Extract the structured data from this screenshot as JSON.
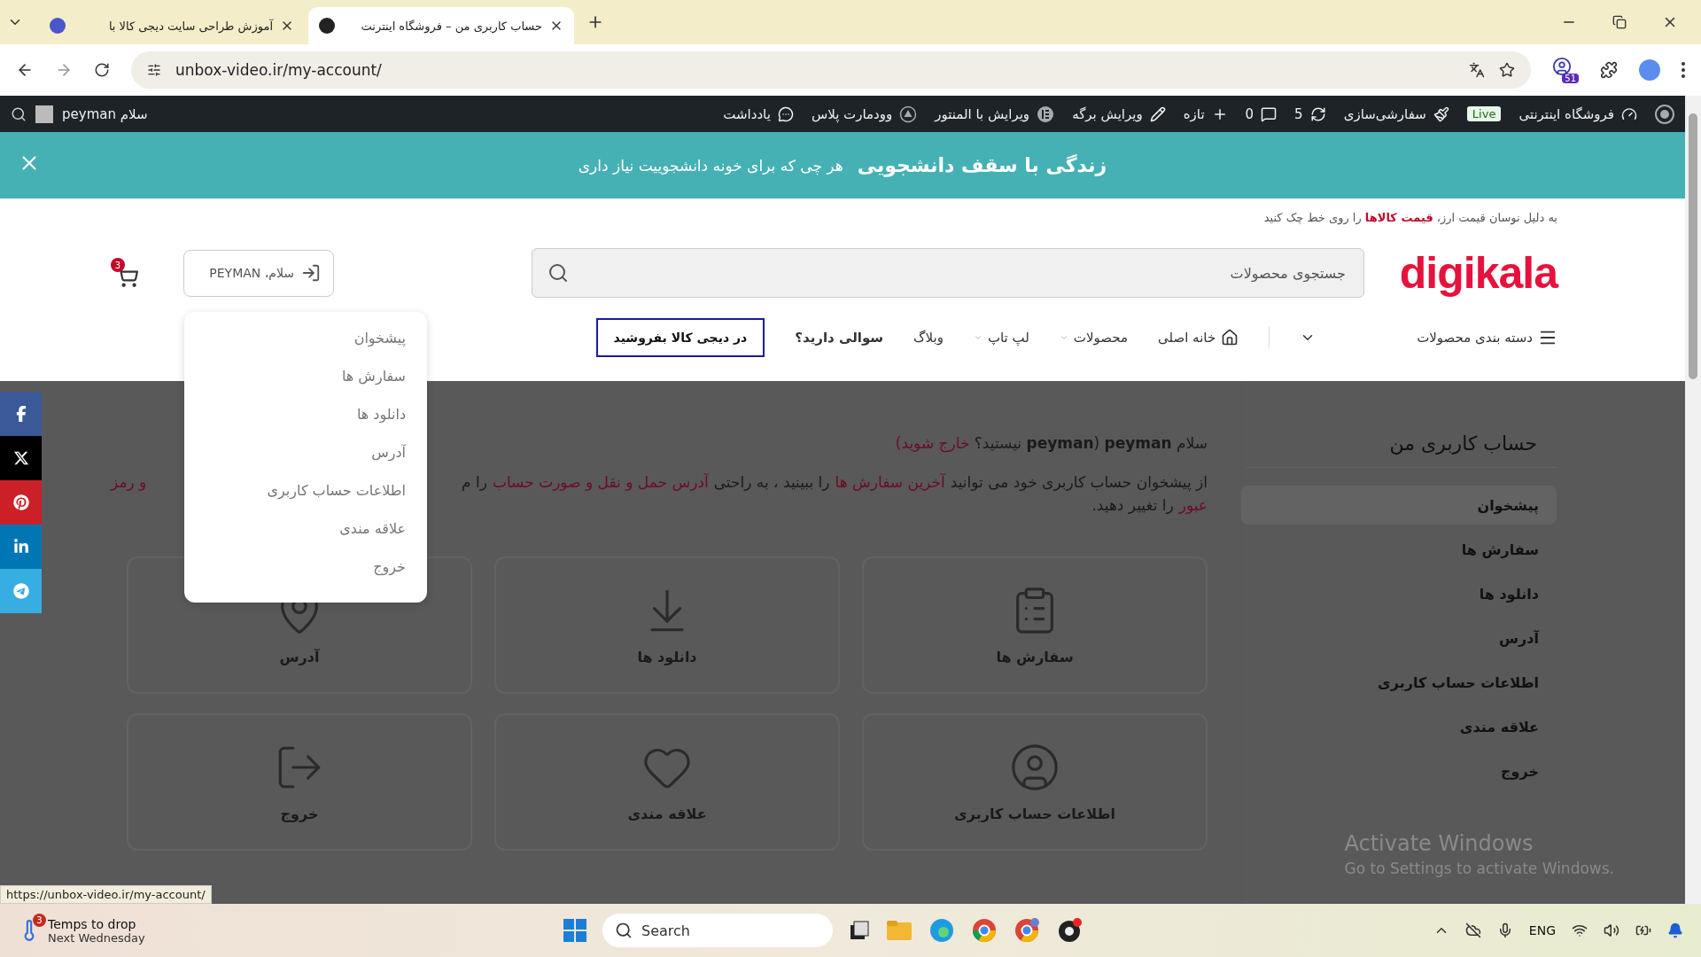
{
  "browser": {
    "tabs": [
      {
        "title": "حساب کاربری من – فروشگاه اینترنت",
        "selected": true
      },
      {
        "title": "آموزش طراحی سایت دیجی کالا با",
        "selected": false
      }
    ],
    "url": "unbox-video.ir/my-account/",
    "extension_badge": "51"
  },
  "admin_bar": {
    "items": [
      {
        "label": "فروشگاه اینترنتی",
        "kind": "item"
      },
      {
        "label": "Live",
        "kind": "badge"
      },
      {
        "label": "سفارشی‌سازی",
        "kind": "item"
      },
      {
        "label": "5",
        "kind": "item"
      },
      {
        "label": "0",
        "kind": "item"
      },
      {
        "label": "تازه",
        "kind": "item"
      },
      {
        "label": "ویرایش برگه",
        "kind": "item"
      },
      {
        "label": "ویرایش با المنتور",
        "kind": "item"
      },
      {
        "label": "وودمارت پلاس",
        "kind": "item"
      },
      {
        "label": "یادداشت",
        "kind": "item"
      }
    ],
    "greeting": "سلام peyman"
  },
  "banner": {
    "title": "زندگی با سقف دانشجویی",
    "text": "هر چی که برای خونه دانشجوییت نیاز داری"
  },
  "header": {
    "notice": "به دلیل نوسان قیمت ارز، **قیمت کالاها** را روی خط چک کنید",
    "logo": "digikala",
    "search": {
      "placeholder": "جستجوی محصولات"
    },
    "account": "سلام، PEYMAN",
    "cart_count": "3"
  },
  "nav": {
    "categories": "دسته بندی محصولات",
    "items": [
      {
        "label": "خانه اصلی",
        "kind": "home"
      },
      {
        "label": "محصولات",
        "kind": "dropdown"
      },
      {
        "label": "لپ تاپ",
        "kind": "dropdown"
      },
      {
        "label": "وبلاگ",
        "kind": "plain"
      },
      {
        "label": "سوالی دارید؟",
        "kind": "bold"
      }
    ],
    "cta": "در دیجی کالا بفروشید"
  },
  "account_menu": [
    "پیشخوان",
    "سفارش ها",
    "دانلود ها",
    "آدرس",
    "اطلاعات حساب کاربری",
    "علاقه مندی",
    "خروج"
  ],
  "sidebar": {
    "title": "حساب کاربری من",
    "items": [
      {
        "label": "پیشخوان",
        "selected": true
      },
      {
        "label": "سفارش ها",
        "selected": false
      },
      {
        "label": "دانلود ها",
        "selected": false
      },
      {
        "label": "آدرس",
        "selected": false
      },
      {
        "label": "اطلاعات حساب کاربری",
        "selected": false
      },
      {
        "label": "علاقه مندی",
        "selected": false
      },
      {
        "label": "خروج",
        "selected": false
      }
    ]
  },
  "content": {
    "greeting": "سلام **peyman** (**peyman** نیستید؟",
    "logout_link": "خارج شوید)",
    "intro": [
      {
        "text": "از پیشخوان حساب کاربری خود می توانید",
        "link": false
      },
      {
        "text": "آخرین سفارش ها",
        "link": true
      },
      {
        "text": "را ببینید ، به راحتی",
        "link": false
      },
      {
        "text": "آدرس حمل و نقل و صورت حساب",
        "link": true
      },
      {
        "text": "را م",
        "link": false
      }
    ],
    "intro_tail": "و رمز",
    "intro_line2": [
      {
        "text": "عبور",
        "link": true
      },
      {
        "text": "را تغییر دهید.",
        "link": false
      }
    ]
  },
  "cards": [
    "سفارش ها",
    "دانلود ها",
    "آدرس",
    "اطلاعات حساب کاربری",
    "علاقه مندی",
    "خروج"
  ],
  "status_url": "https://unbox-video.ir/my-account/",
  "activation": {
    "title": "Activate Windows",
    "text": "Go to Settings to activate Windows."
  },
  "taskbar": {
    "weather": {
      "title": "Temps to drop",
      "subtitle": "Next Wednesday",
      "badge": "3"
    },
    "search": {
      "placeholder": "Search"
    },
    "language": "ENG"
  }
}
